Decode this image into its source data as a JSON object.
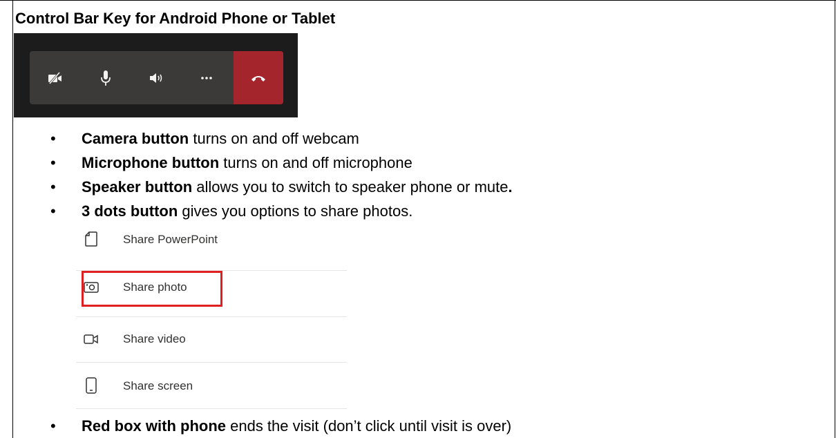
{
  "title": "Control Bar Key for Android Phone or Tablet",
  "control_bar": {
    "buttons": [
      {
        "name": "camera-off-icon"
      },
      {
        "name": "microphone-icon"
      },
      {
        "name": "speaker-icon"
      },
      {
        "name": "more-dots-icon"
      },
      {
        "name": "hang-up-icon"
      }
    ],
    "colors": {
      "background": "#1c1c1c",
      "bar": "#3b3a39",
      "end_call": "#a4262c"
    }
  },
  "bullets": [
    {
      "bold": "Camera button",
      "rest": " turns on and off webcam"
    },
    {
      "bold": "Microphone button",
      "rest": " turns on and off microphone"
    },
    {
      "bold": "Speaker button",
      "rest": " allows you to switch to speaker phone or mute",
      "tail": "."
    },
    {
      "bold": "3 dots button",
      "rest": " gives you options to share photos."
    },
    {
      "bold": "Red box with phone",
      "rest": " ends the visit (don’t click until visit is over)"
    }
  ],
  "menu": {
    "items": [
      {
        "label": "Share PowerPoint",
        "icon": "document-icon"
      },
      {
        "label": "Share photo",
        "icon": "photo-icon"
      },
      {
        "label": "Share video",
        "icon": "video-icon"
      },
      {
        "label": "Share screen",
        "icon": "phone-screen-icon"
      }
    ],
    "highlight_color": "#e02020"
  }
}
